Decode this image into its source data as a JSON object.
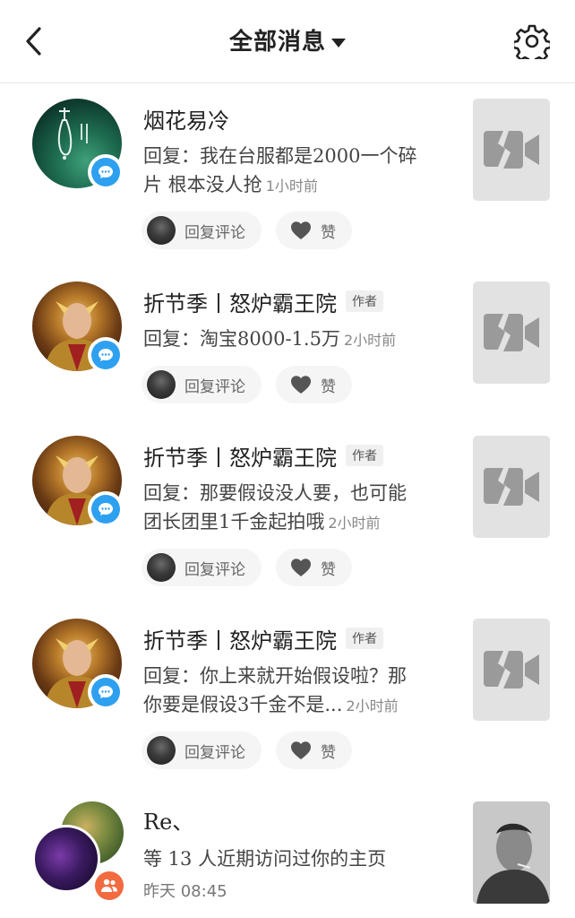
{
  "header": {
    "title": "全部消息"
  },
  "messages": [
    {
      "name": "烟花易冷",
      "is_author": false,
      "reply_line1": "回复：我在台服都是2000一个碎",
      "reply_line2": "片  根本没人抢",
      "time": "1小时前",
      "reply_button": "回复评论",
      "like_button": "赞"
    },
    {
      "name": "折节季丨怒炉霸王院",
      "is_author": true,
      "author_tag": "作者",
      "reply_line1": "回复：淘宝8000-1.5万",
      "time": "2小时前",
      "reply_button": "回复评论",
      "like_button": "赞"
    },
    {
      "name": "折节季丨怒炉霸王院",
      "is_author": true,
      "author_tag": "作者",
      "reply_line1": "回复：那要假设没人要，也可能",
      "reply_line2": "团长团里1千金起拍哦",
      "time": "2小时前",
      "reply_button": "回复评论",
      "like_button": "赞"
    },
    {
      "name": "折节季丨怒炉霸王院",
      "is_author": true,
      "author_tag": "作者",
      "reply_line1": "回复：你上来就开始假设啦？那",
      "reply_line2": "你要是假设3千金不是...",
      "time": "2小时前",
      "reply_button": "回复评论",
      "like_button": "赞"
    }
  ],
  "visitors": {
    "name": "Re、",
    "text": "等 13 人近期访问过你的主页",
    "time": "昨天 08:45"
  },
  "colors": {
    "badge_blue": "#2ea0f0",
    "badge_orange": "#f26a3f"
  }
}
